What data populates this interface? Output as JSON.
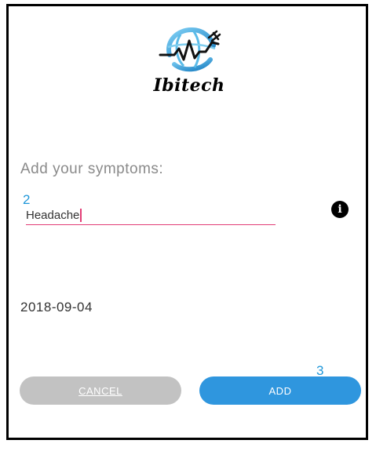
{
  "app": {
    "name": "Ibitech"
  },
  "form": {
    "prompt": "Add your symptoms:",
    "symptom_value": "Headache",
    "date": "2018-09-04"
  },
  "annotations": {
    "field_marker": "2",
    "button_marker": "3"
  },
  "buttons": {
    "cancel": "CANCEL",
    "add": "ADD"
  },
  "icons": {
    "info": "info-icon",
    "logo": "globe-heartbeat-logo"
  },
  "colors": {
    "accent_pink": "#e23e76",
    "primary_blue": "#2f96de",
    "disabled_gray": "#c2c2c2",
    "annotation_blue": "#1f97d9"
  }
}
